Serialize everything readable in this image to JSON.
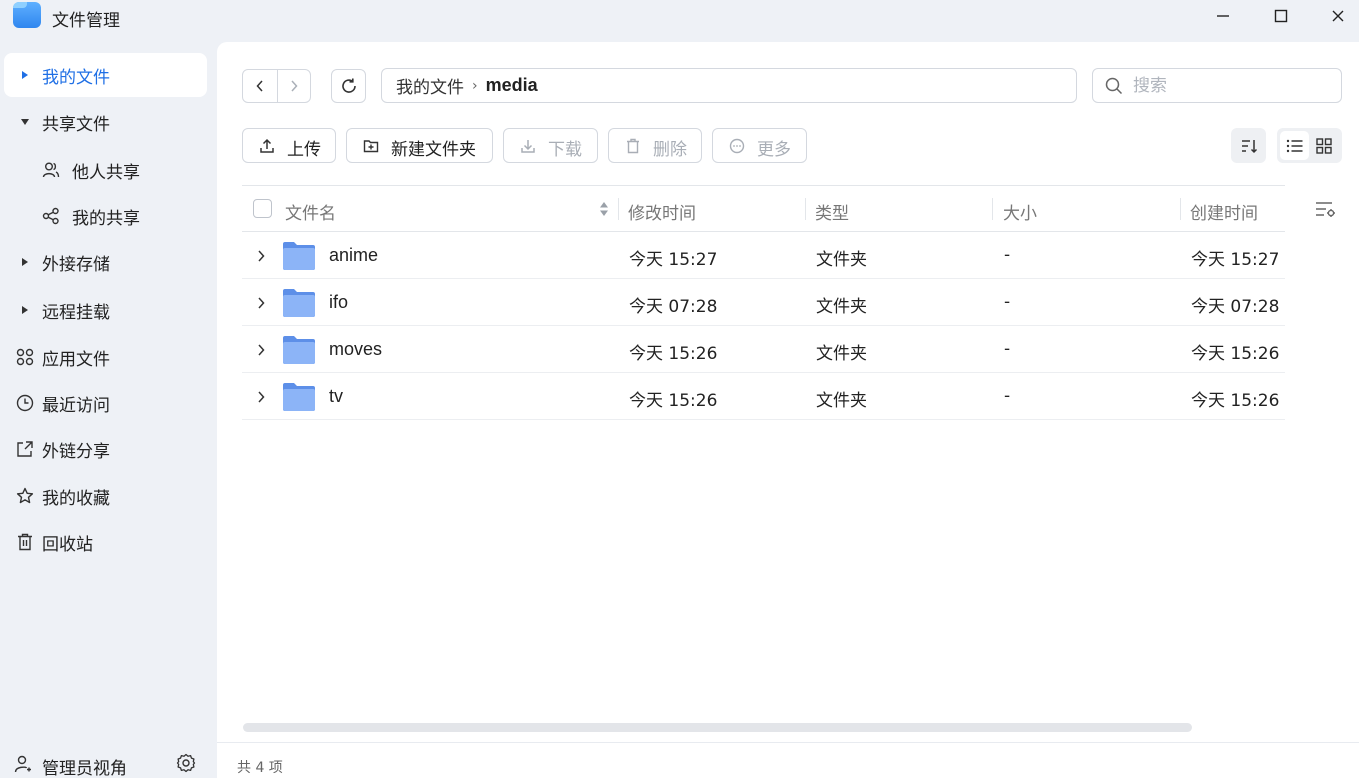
{
  "app": {
    "title": "文件管理"
  },
  "window": {
    "minimize": "minimize-icon",
    "maximize": "maximize-icon",
    "close": "close-icon"
  },
  "sidebar": {
    "items": [
      {
        "label": "我的文件",
        "icon": "triangle-right",
        "active": true
      },
      {
        "label": "共享文件",
        "icon": "triangle-down"
      },
      {
        "label": "他人共享",
        "icon": "users-icon",
        "sub": true
      },
      {
        "label": "我的共享",
        "icon": "share-icon",
        "sub": true
      },
      {
        "label": "外接存储",
        "icon": "triangle-right"
      },
      {
        "label": "远程挂载",
        "icon": "triangle-right"
      },
      {
        "label": "应用文件",
        "icon": "apps-icon"
      },
      {
        "label": "最近访问",
        "icon": "clock-icon"
      },
      {
        "label": "外链分享",
        "icon": "external-share-icon"
      },
      {
        "label": "我的收藏",
        "icon": "star-icon"
      },
      {
        "label": "回收站",
        "icon": "trash-icon"
      }
    ],
    "footer": {
      "label": "管理员视角",
      "icon": "admin-user-icon",
      "settings": "gear-icon"
    }
  },
  "breadcrumb": {
    "root": "我的文件",
    "current": "media"
  },
  "search": {
    "placeholder": "搜索",
    "value": ""
  },
  "toolbar": {
    "upload": "上传",
    "new_folder": "新建文件夹",
    "download": "下载",
    "delete": "删除",
    "more": "更多"
  },
  "table": {
    "columns": {
      "name": "文件名",
      "modified": "修改时间",
      "type": "类型",
      "size": "大小",
      "created": "创建时间"
    },
    "rows": [
      {
        "name": "anime",
        "modified": "今天 15:27",
        "type": "文件夹",
        "size": "-",
        "created": "今天 15:27"
      },
      {
        "name": "ifo",
        "modified": "今天 07:28",
        "type": "文件夹",
        "size": "-",
        "created": "今天 07:28"
      },
      {
        "name": "moves",
        "modified": "今天 15:26",
        "type": "文件夹",
        "size": "-",
        "created": "今天 15:26"
      },
      {
        "name": "tv",
        "modified": "今天 15:26",
        "type": "文件夹",
        "size": "-",
        "created": "今天 15:26"
      }
    ]
  },
  "status": {
    "count": "共 4 项"
  },
  "colors": {
    "accent": "#1f6fe5",
    "folder": "#7aa9f5",
    "sidebar_bg": "#eef1f6"
  }
}
